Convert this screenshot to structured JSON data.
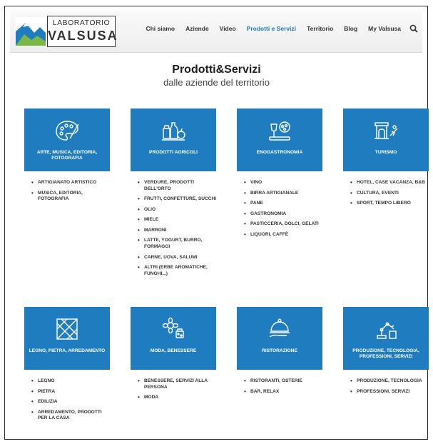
{
  "header": {
    "logo_top": "LABORATORIO",
    "logo_bottom": "VALSUSA",
    "nav": [
      {
        "label": "Chi siamo"
      },
      {
        "label": "Aziende"
      },
      {
        "label": "Video"
      },
      {
        "label": "Prodotti e Servizi",
        "active": true
      },
      {
        "label": "Territorio"
      },
      {
        "label": "Blog"
      },
      {
        "label": "My Valsusa"
      }
    ],
    "search_icon": "search-icon"
  },
  "page": {
    "title": "Prodotti&Servizi",
    "subtitle": "dalle aziende del territorio"
  },
  "theme": {
    "tile_color": "#1e7cbf",
    "active_nav_color": "#1e7cbf"
  },
  "categories": [
    {
      "label": "ARTE, MUSICA, EDITORIA, FOTOGRAFIA",
      "icon": "palette-icon",
      "items": [
        "ARTIGIANATO ARTISTICO",
        "MUSICA, EDITORIA, FOTOGRAFIA"
      ]
    },
    {
      "label": "PRODOTTI AGRICOLI",
      "icon": "farm-products-icon",
      "items": [
        "VERDURE, PRODOTTI DELL'ORTO",
        "FRUTTI, CONFETTURE, SUCCHI",
        "OLIO",
        "MIELE",
        "MARRONI",
        "LATTE, YOGURT, BURRO, FORMAGGI",
        "CARNE, UOVA, SALUMI",
        "ALTRI (ERBE AROMATICHE, FUNGHI...)"
      ]
    },
    {
      "label": "ENOGASTRONOMIA",
      "icon": "wine-food-icon",
      "items": [
        "VINO",
        "BIRRA ARTIGIANALE",
        "PANE",
        "GASTRONOMIA",
        "PASTICCERIA, DOLCI, GELATI",
        "LIQUORI, CAFFÈ"
      ]
    },
    {
      "label": "TURISMO",
      "icon": "tourism-icon",
      "items": [
        "HOTEL, CASE VACANZA, B&B",
        "CULTURA, EVENTI",
        "SPORT, TEMPO LIBERO"
      ]
    },
    {
      "label": "LEGNO, PIETRA, ARREDAMENTO",
      "icon": "wood-stone-icon",
      "items": [
        "LEGNO",
        "PIETRA",
        "EDILIZIA",
        "ARREDAMENTO, PRODOTTI PER LA CASA"
      ]
    },
    {
      "label": "MODA, BENESSERE",
      "icon": "wellness-icon",
      "items": [
        "BENESSERE, SERVIZI ALLA PERSONA",
        "MODA"
      ]
    },
    {
      "label": "RISTORAZIONE",
      "icon": "cloche-icon",
      "items": [
        "RISTORANTI, OSTERIE",
        "BAR, RELAX"
      ]
    },
    {
      "label": "PRODUZIONE, TECNOLOGIA, PROFESSIONI, SERVIZI",
      "icon": "robot-arm-icon",
      "items": [
        "PRODUZIONE, TECNOLOGIA",
        "PROFESSIONI, SERVIZI"
      ]
    }
  ]
}
